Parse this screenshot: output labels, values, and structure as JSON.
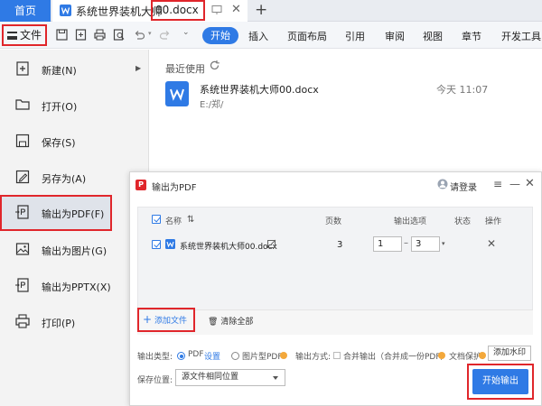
{
  "titlebar": {
    "home_tab": "首页",
    "doc_tab_name": "系统世界装机大师",
    "doc_tab_ext": "00.docx",
    "new_tab": "+"
  },
  "toolbar": {
    "file_menu": "文件",
    "start": "开始",
    "tabs": [
      "插入",
      "页面布局",
      "引用",
      "审阅",
      "视图",
      "章节",
      "开发工具"
    ]
  },
  "sidebar": {
    "items": [
      {
        "label": "新建(N)",
        "icon": "new-file-icon"
      },
      {
        "label": "打开(O)",
        "icon": "open-folder-icon"
      },
      {
        "label": "保存(S)",
        "icon": "save-icon"
      },
      {
        "label": "另存为(A)",
        "icon": "save-as-icon"
      },
      {
        "label": "输出为PDF(F)",
        "icon": "export-pdf-icon"
      },
      {
        "label": "输出为图片(G)",
        "icon": "export-image-icon"
      },
      {
        "label": "输出为PPTX(X)",
        "icon": "export-pptx-icon"
      },
      {
        "label": "打印(P)",
        "icon": "print-icon"
      }
    ]
  },
  "recent": {
    "title": "最近使用",
    "file_name": "系统世界装机大师00.docx",
    "file_path": "E:/郑/",
    "time": "今天  11:07"
  },
  "dialog": {
    "title": "输出为PDF",
    "login": "请登录",
    "headers": {
      "name": "名称",
      "pages": "页数",
      "output_options": "输出选项",
      "status": "状态",
      "action": "操作"
    },
    "row": {
      "name": "系统世界装机大师00.docx",
      "pages": "3",
      "range_from": "1",
      "range_to": "3"
    },
    "add_file": "添加文件",
    "clear_all": "清除全部",
    "output_type_label": "输出类型:",
    "pdf_label": "PDF",
    "settings_label": "设置",
    "image_pdf_label": "图片型PDF",
    "output_mode_label": "输出方式:",
    "merge_label": "合并输出（合并成一份PDF）",
    "protect_label": "文档保护:",
    "watermark_btn": "添加水印",
    "save_label": "保存位置:",
    "save_value": "源文件相同位置",
    "export_btn": "开始输出"
  },
  "colors": {
    "accent": "#2f7ae5",
    "highlight": "#e0262b",
    "pdf_red": "#e0262b",
    "vip_coin": "#f3a83b"
  }
}
